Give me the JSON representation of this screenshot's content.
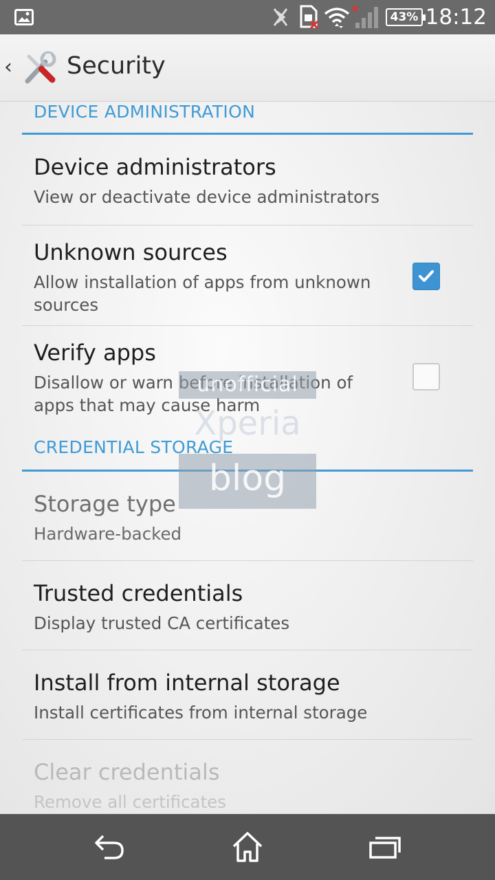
{
  "status_bar": {
    "time": "18:12",
    "battery": "43%",
    "icons": [
      "image-notification-icon",
      "nfc-off-icon",
      "sim-error-icon",
      "wifi-icon",
      "signal-icon",
      "battery-icon"
    ]
  },
  "action_bar": {
    "title": "Security",
    "back_glyph": "‹",
    "app_icon": "wrench-screwdriver-icon"
  },
  "sections": {
    "device_admin": {
      "header": "DEVICE ADMINISTRATION"
    },
    "credential": {
      "header": "CREDENTIAL STORAGE"
    }
  },
  "prefs": {
    "device_admins": {
      "title": "Device administrators",
      "summary": "View or deactivate device administrators"
    },
    "unknown_sources": {
      "title": "Unknown sources",
      "summary": "Allow installation of apps from unknown sources",
      "checked": true
    },
    "verify_apps": {
      "title": "Verify apps",
      "summary": "Disallow or warn before installation of apps that may cause harm",
      "checked": false
    },
    "storage_type": {
      "title": "Storage type",
      "summary": "Hardware-backed"
    },
    "trusted_credentials": {
      "title": "Trusted credentials",
      "summary": "Display trusted CA certificates"
    },
    "install_storage": {
      "title": "Install from internal storage",
      "summary": "Install certificates from internal storage"
    },
    "clear_credentials": {
      "title": "Clear credentials",
      "summary": "Remove all certificates"
    }
  },
  "watermark": {
    "line1": "unofficial",
    "line2": "Xperia",
    "line3": "blog"
  },
  "colors": {
    "accent": "#3f9ad6",
    "status_bar": "#6a6a6a",
    "nav_bar": "#545454",
    "checkbox": "#3e93d3"
  },
  "nav_bar": {
    "icons": [
      "back-icon",
      "home-icon",
      "recent-apps-icon"
    ]
  }
}
